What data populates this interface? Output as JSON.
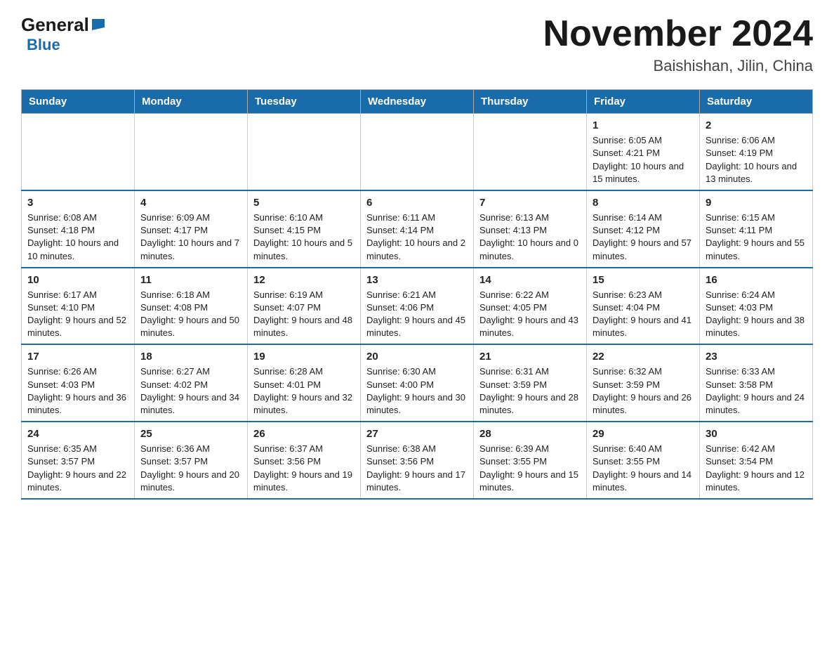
{
  "header": {
    "title": "November 2024",
    "subtitle": "Baishishan, Jilin, China",
    "logo_general": "General",
    "logo_blue": "Blue"
  },
  "weekdays": [
    "Sunday",
    "Monday",
    "Tuesday",
    "Wednesday",
    "Thursday",
    "Friday",
    "Saturday"
  ],
  "weeks": [
    [
      {
        "day": "",
        "info": ""
      },
      {
        "day": "",
        "info": ""
      },
      {
        "day": "",
        "info": ""
      },
      {
        "day": "",
        "info": ""
      },
      {
        "day": "",
        "info": ""
      },
      {
        "day": "1",
        "info": "Sunrise: 6:05 AM\nSunset: 4:21 PM\nDaylight: 10 hours and 15 minutes."
      },
      {
        "day": "2",
        "info": "Sunrise: 6:06 AM\nSunset: 4:19 PM\nDaylight: 10 hours and 13 minutes."
      }
    ],
    [
      {
        "day": "3",
        "info": "Sunrise: 6:08 AM\nSunset: 4:18 PM\nDaylight: 10 hours and 10 minutes."
      },
      {
        "day": "4",
        "info": "Sunrise: 6:09 AM\nSunset: 4:17 PM\nDaylight: 10 hours and 7 minutes."
      },
      {
        "day": "5",
        "info": "Sunrise: 6:10 AM\nSunset: 4:15 PM\nDaylight: 10 hours and 5 minutes."
      },
      {
        "day": "6",
        "info": "Sunrise: 6:11 AM\nSunset: 4:14 PM\nDaylight: 10 hours and 2 minutes."
      },
      {
        "day": "7",
        "info": "Sunrise: 6:13 AM\nSunset: 4:13 PM\nDaylight: 10 hours and 0 minutes."
      },
      {
        "day": "8",
        "info": "Sunrise: 6:14 AM\nSunset: 4:12 PM\nDaylight: 9 hours and 57 minutes."
      },
      {
        "day": "9",
        "info": "Sunrise: 6:15 AM\nSunset: 4:11 PM\nDaylight: 9 hours and 55 minutes."
      }
    ],
    [
      {
        "day": "10",
        "info": "Sunrise: 6:17 AM\nSunset: 4:10 PM\nDaylight: 9 hours and 52 minutes."
      },
      {
        "day": "11",
        "info": "Sunrise: 6:18 AM\nSunset: 4:08 PM\nDaylight: 9 hours and 50 minutes."
      },
      {
        "day": "12",
        "info": "Sunrise: 6:19 AM\nSunset: 4:07 PM\nDaylight: 9 hours and 48 minutes."
      },
      {
        "day": "13",
        "info": "Sunrise: 6:21 AM\nSunset: 4:06 PM\nDaylight: 9 hours and 45 minutes."
      },
      {
        "day": "14",
        "info": "Sunrise: 6:22 AM\nSunset: 4:05 PM\nDaylight: 9 hours and 43 minutes."
      },
      {
        "day": "15",
        "info": "Sunrise: 6:23 AM\nSunset: 4:04 PM\nDaylight: 9 hours and 41 minutes."
      },
      {
        "day": "16",
        "info": "Sunrise: 6:24 AM\nSunset: 4:03 PM\nDaylight: 9 hours and 38 minutes."
      }
    ],
    [
      {
        "day": "17",
        "info": "Sunrise: 6:26 AM\nSunset: 4:03 PM\nDaylight: 9 hours and 36 minutes."
      },
      {
        "day": "18",
        "info": "Sunrise: 6:27 AM\nSunset: 4:02 PM\nDaylight: 9 hours and 34 minutes."
      },
      {
        "day": "19",
        "info": "Sunrise: 6:28 AM\nSunset: 4:01 PM\nDaylight: 9 hours and 32 minutes."
      },
      {
        "day": "20",
        "info": "Sunrise: 6:30 AM\nSunset: 4:00 PM\nDaylight: 9 hours and 30 minutes."
      },
      {
        "day": "21",
        "info": "Sunrise: 6:31 AM\nSunset: 3:59 PM\nDaylight: 9 hours and 28 minutes."
      },
      {
        "day": "22",
        "info": "Sunrise: 6:32 AM\nSunset: 3:59 PM\nDaylight: 9 hours and 26 minutes."
      },
      {
        "day": "23",
        "info": "Sunrise: 6:33 AM\nSunset: 3:58 PM\nDaylight: 9 hours and 24 minutes."
      }
    ],
    [
      {
        "day": "24",
        "info": "Sunrise: 6:35 AM\nSunset: 3:57 PM\nDaylight: 9 hours and 22 minutes."
      },
      {
        "day": "25",
        "info": "Sunrise: 6:36 AM\nSunset: 3:57 PM\nDaylight: 9 hours and 20 minutes."
      },
      {
        "day": "26",
        "info": "Sunrise: 6:37 AM\nSunset: 3:56 PM\nDaylight: 9 hours and 19 minutes."
      },
      {
        "day": "27",
        "info": "Sunrise: 6:38 AM\nSunset: 3:56 PM\nDaylight: 9 hours and 17 minutes."
      },
      {
        "day": "28",
        "info": "Sunrise: 6:39 AM\nSunset: 3:55 PM\nDaylight: 9 hours and 15 minutes."
      },
      {
        "day": "29",
        "info": "Sunrise: 6:40 AM\nSunset: 3:55 PM\nDaylight: 9 hours and 14 minutes."
      },
      {
        "day": "30",
        "info": "Sunrise: 6:42 AM\nSunset: 3:54 PM\nDaylight: 9 hours and 12 minutes."
      }
    ]
  ]
}
